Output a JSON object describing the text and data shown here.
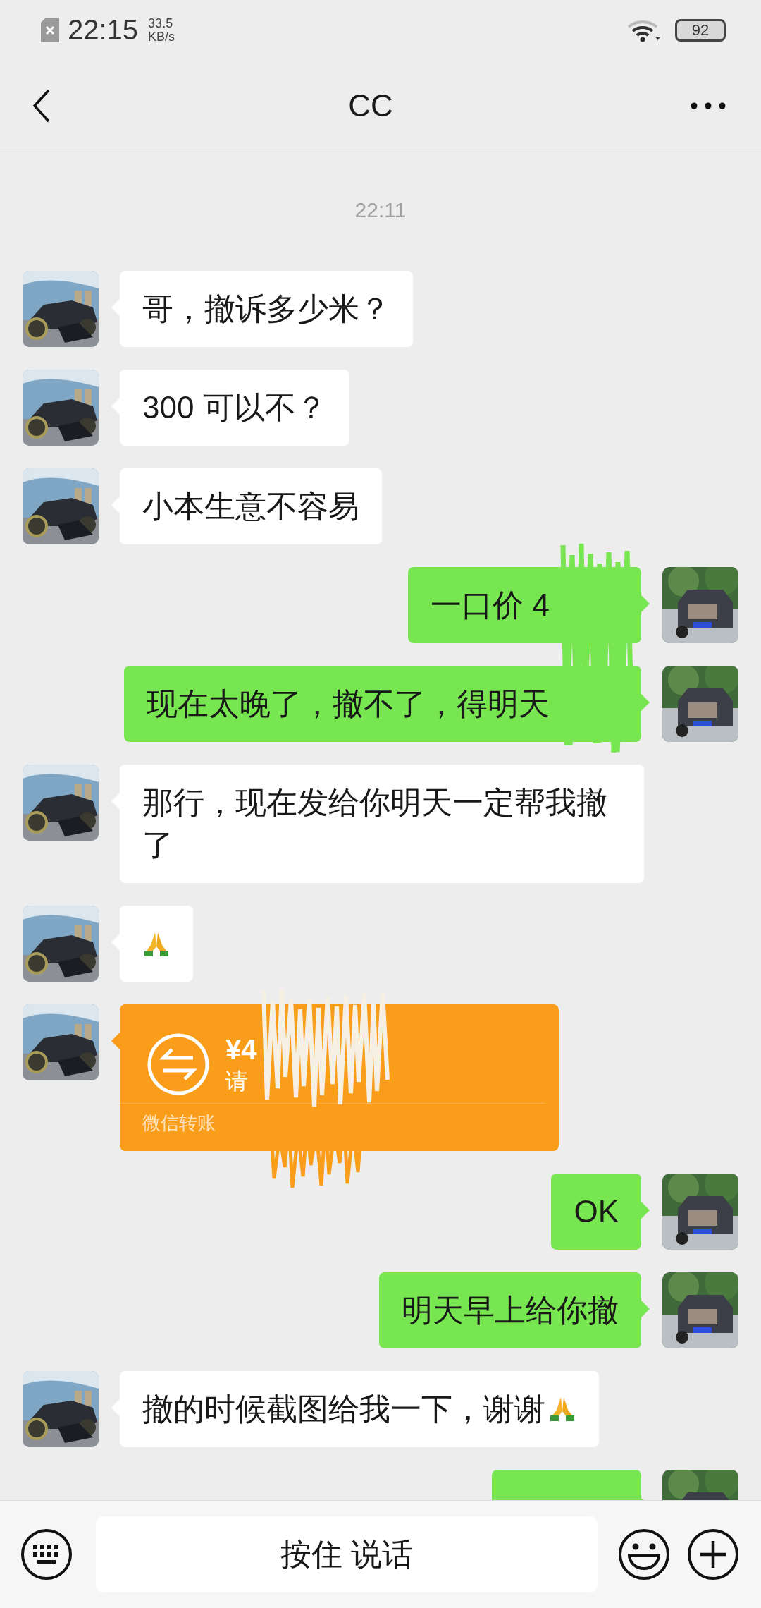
{
  "status_bar": {
    "time": "22:15",
    "speed": "33.5",
    "speed_unit": "KB/s",
    "battery": "92"
  },
  "header": {
    "title": "CC"
  },
  "timestamp": "22:11",
  "messages": [
    {
      "sent": false,
      "kind": "text",
      "text": "哥，撤诉多少米？"
    },
    {
      "sent": false,
      "kind": "text",
      "text": "300 可以不？"
    },
    {
      "sent": false,
      "kind": "text",
      "text": "小本生意不容易"
    },
    {
      "sent": true,
      "kind": "text",
      "text": "一口价 4",
      "redacted": true
    },
    {
      "sent": true,
      "kind": "text",
      "text": "现在太晚了，撤不了，得明天",
      "redacted": true
    },
    {
      "sent": false,
      "kind": "text",
      "text": "那行，现在发给你明天一定帮我撤了"
    },
    {
      "sent": false,
      "kind": "emoji"
    },
    {
      "sent": false,
      "kind": "transfer",
      "amount": "¥4",
      "note": "请",
      "label": "微信转账",
      "redacted": true
    },
    {
      "sent": true,
      "kind": "text",
      "text": "OK"
    },
    {
      "sent": true,
      "kind": "text",
      "text": "明天早上给你撤"
    },
    {
      "sent": false,
      "kind": "text",
      "text": "撤的时候截图给我一下，谢谢",
      "emoji_after": true
    },
    {
      "sent": true,
      "kind": "cut"
    }
  ],
  "input_bar": {
    "hold_to_talk": "按住 说话"
  }
}
